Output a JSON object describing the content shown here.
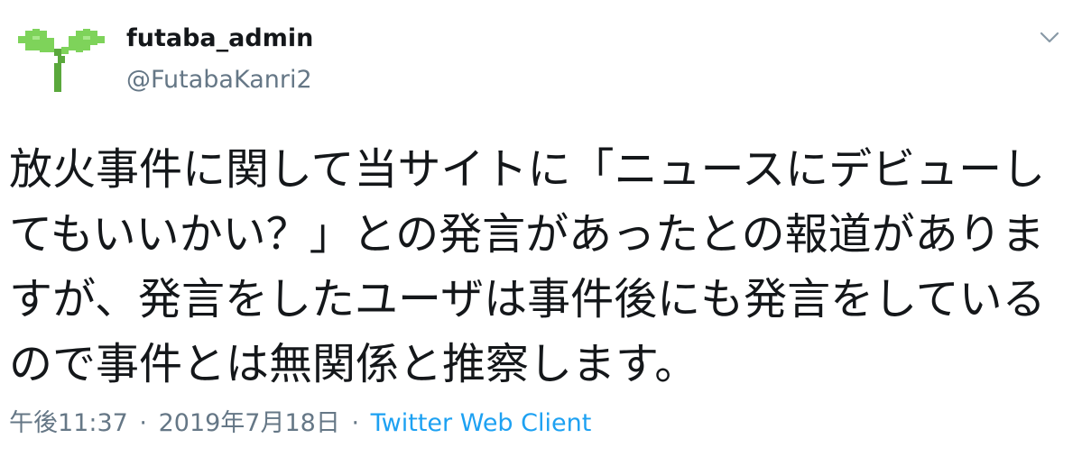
{
  "user": {
    "display_name": "futaba_admin",
    "handle": "@FutabaKanri2",
    "avatar_icon": "sprout-icon"
  },
  "menu": {
    "caret_icon": "chevron-down-icon"
  },
  "tweet": {
    "text": "放火事件に関して当サイトに「ニュースにデビューしてもいいかい？」との発言があったとの報道がありますが、発言をしたユーザは事件後にも発言をしているので事件とは無関係と推察します。"
  },
  "meta": {
    "time": "午後11:37",
    "separator": "·",
    "date": "2019年7月18日",
    "source": "Twitter Web Client"
  },
  "colors": {
    "text": "#14171a",
    "secondary": "#657786",
    "link": "#1da1f2",
    "avatar_green": "#6cc44a"
  }
}
